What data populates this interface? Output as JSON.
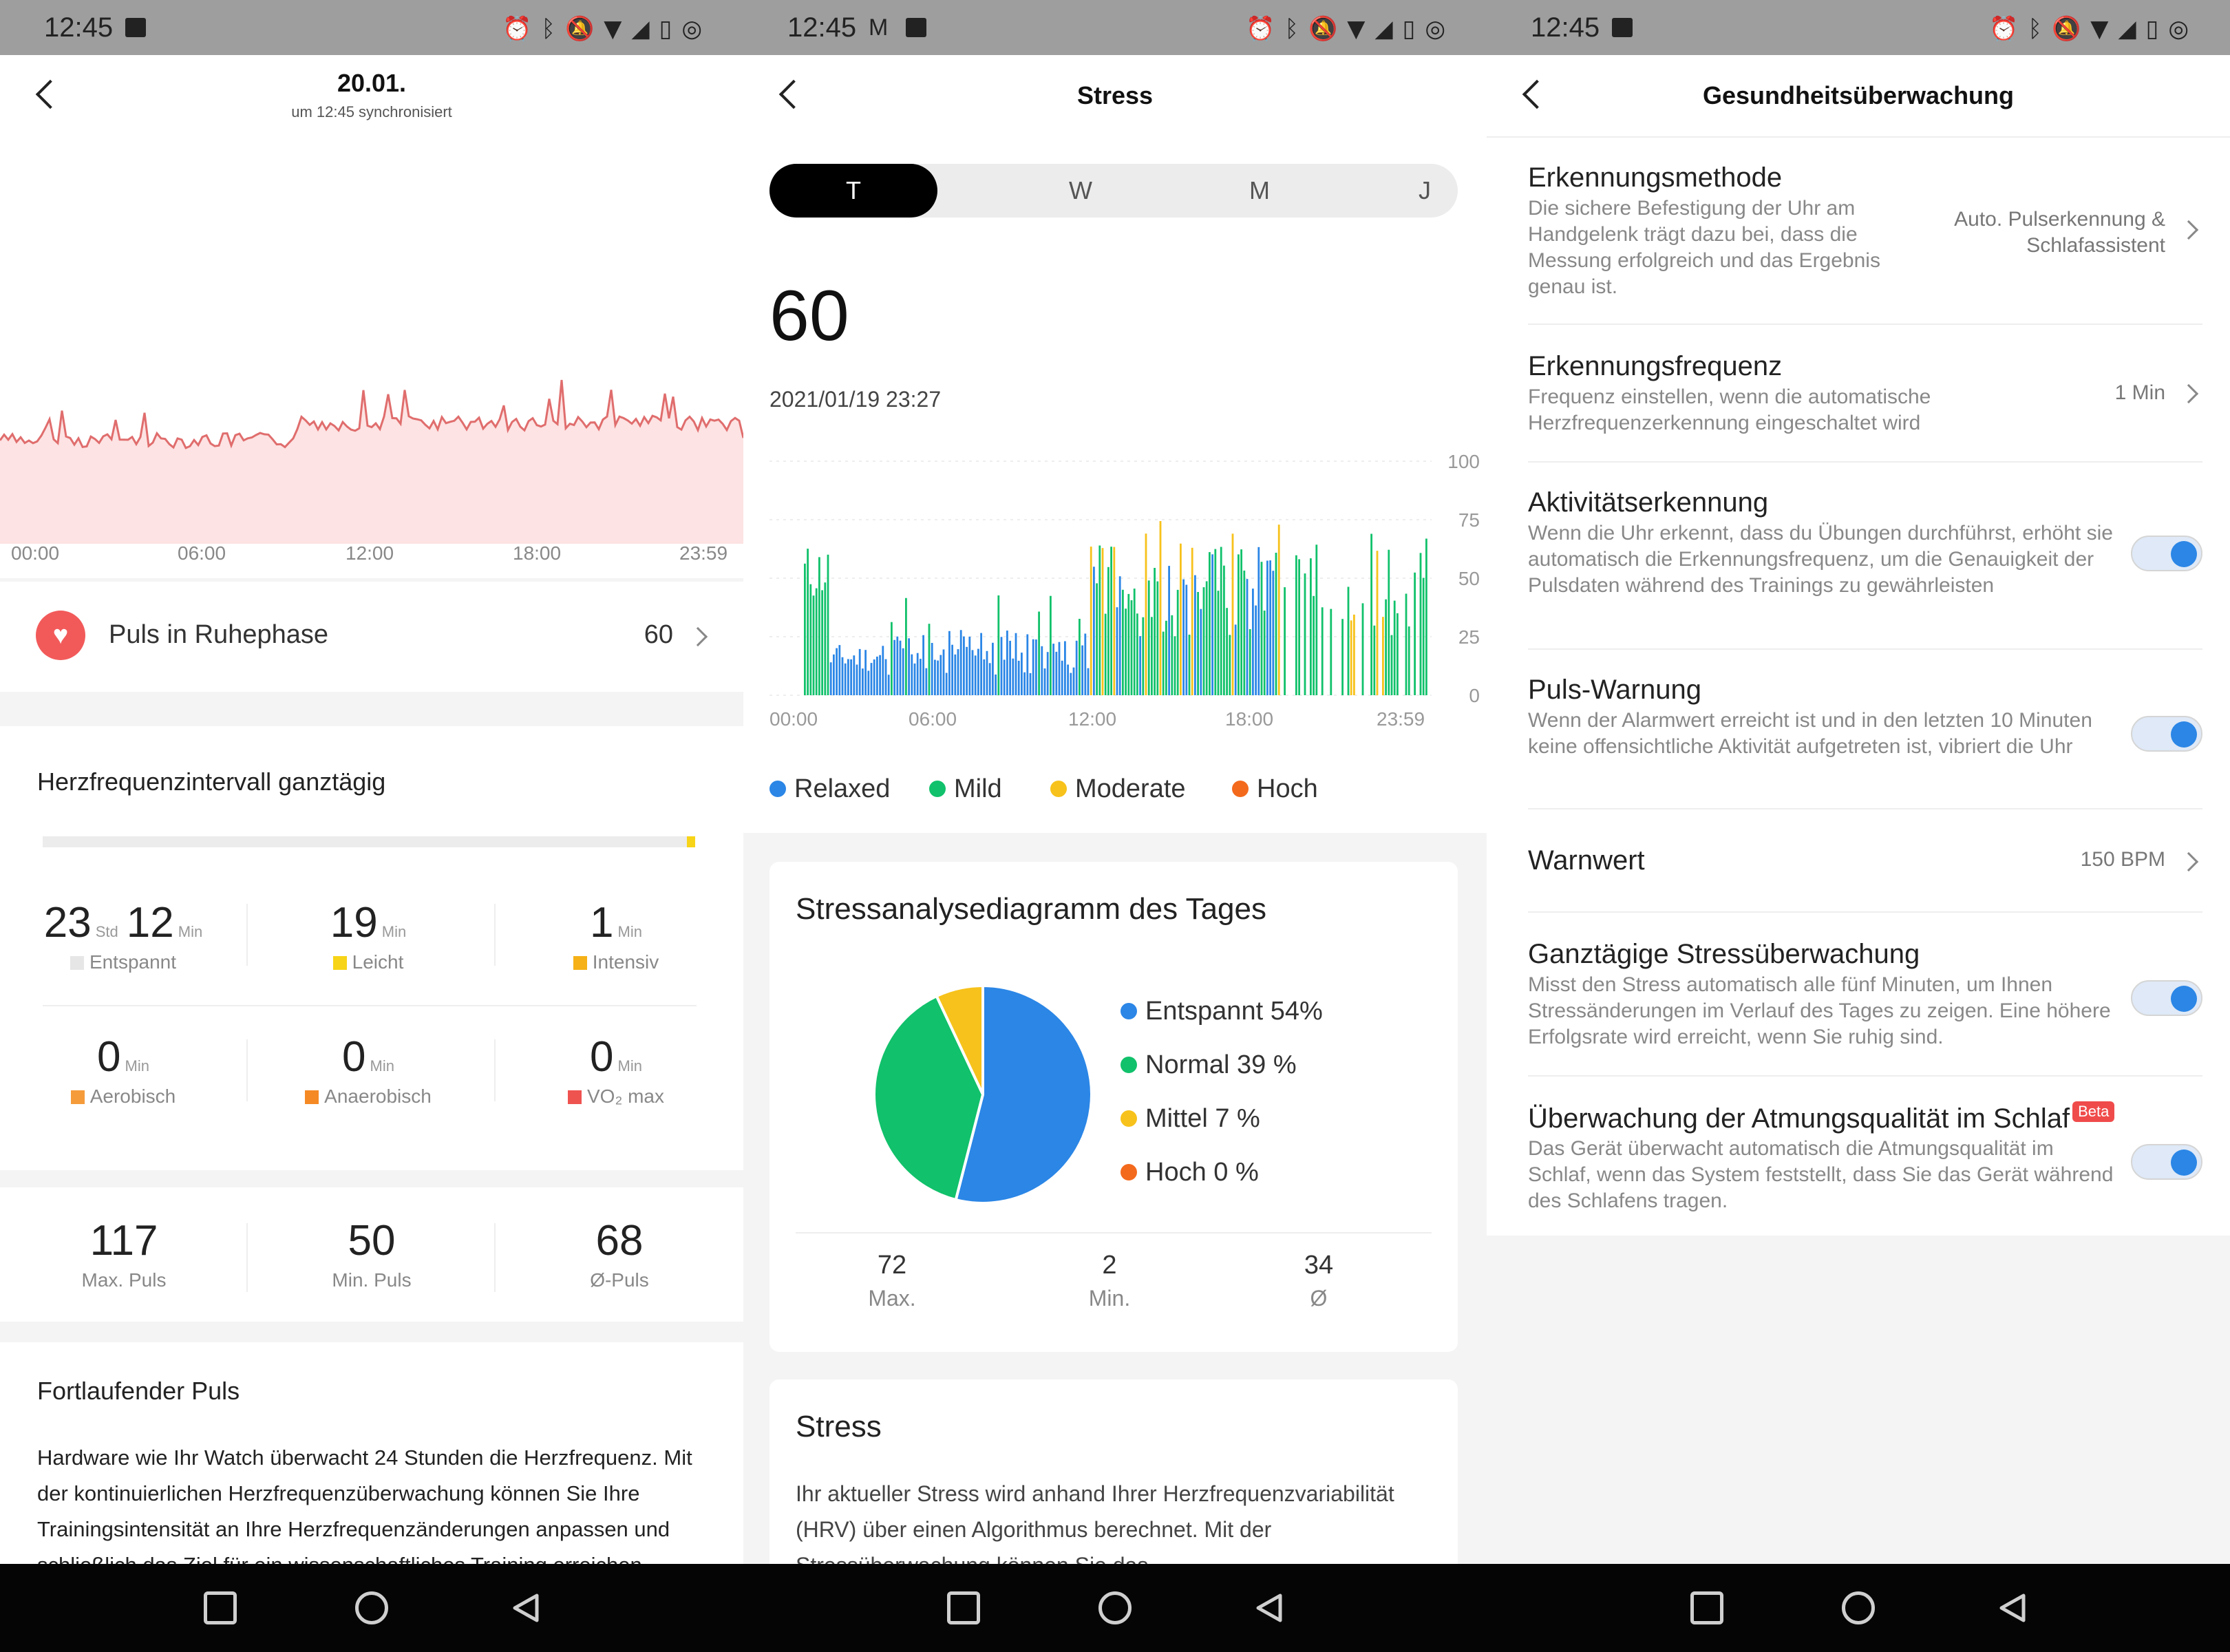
{
  "status_bar": {
    "time": "12:45"
  },
  "panel1": {
    "date": "20.01.",
    "sync": "um 12:45 synchronisiert",
    "hr_axis": [
      "00:00",
      "06:00",
      "12:00",
      "18:00",
      "23:59"
    ],
    "resting": {
      "label": "Puls in Ruhephase",
      "value": "60"
    },
    "zones_title": "Herzfrequenzintervall ganztägig",
    "zones": [
      {
        "value1": "23",
        "unit1": "Std",
        "value2": "12",
        "unit2": "Min",
        "label": "Entspannt",
        "color": "#e6e6e6"
      },
      {
        "value": "19",
        "unit": "Min",
        "label": "Leicht",
        "color": "#f7d417"
      },
      {
        "value": "1",
        "unit": "Min",
        "label": "Intensiv",
        "color": "#f5b117"
      },
      {
        "value": "0",
        "unit": "Min",
        "label": "Aerobisch",
        "color": "#f59b3a"
      },
      {
        "value": "0",
        "unit": "Min",
        "label": "Anaerobisch",
        "color": "#f58a24"
      },
      {
        "value": "0",
        "unit": "Min",
        "label": "VO₂ max",
        "color": "#ef5350"
      }
    ],
    "summary": [
      {
        "value": "117",
        "label": "Max. Puls"
      },
      {
        "value": "50",
        "label": "Min. Puls"
      },
      {
        "value": "68",
        "label": "Ø-Puls"
      }
    ],
    "continuous_title": "Fortlaufender Puls",
    "continuous_text": "Hardware wie Ihr Watch überwacht 24 Stunden die Herzfrequenz. Mit der kontinuierlichen Herzfrequenzüberwachung können Sie Ihre Trainingsintensität an Ihre Herzfrequenzänderungen anpassen und schließlich das Ziel für ein wissenschaftliches Training erreichen."
  },
  "panel2": {
    "title": "Stress",
    "tabs": [
      "T",
      "W",
      "M",
      "J"
    ],
    "selected_tab": "T",
    "value": "60",
    "datetime": "2021/01/19 23:27",
    "y_ticks": [
      "100",
      "75",
      "50",
      "25",
      "0"
    ],
    "x_ticks": [
      "00:00",
      "06:00",
      "12:00",
      "18:00",
      "23:59"
    ],
    "legend": [
      {
        "label": "Relaxed",
        "color": "#2b86e6"
      },
      {
        "label": "Mild",
        "color": "#11c16b"
      },
      {
        "label": "Moderate",
        "color": "#f7c21b"
      },
      {
        "label": "Hoch",
        "color": "#f36a1d"
      }
    ],
    "analysis_title": "Stressanalysediagramm des Tages",
    "pie_legend": [
      {
        "label": "Entspannt 54%",
        "color": "#2b86e6"
      },
      {
        "label": "Normal 39 %",
        "color": "#11c16b"
      },
      {
        "label": "Mittel 7 %",
        "color": "#f7c21b"
      },
      {
        "label": "Hoch 0 %",
        "color": "#f36a1d"
      }
    ],
    "kpis": [
      {
        "value": "72",
        "label": "Max."
      },
      {
        "value": "2",
        "label": "Min."
      },
      {
        "value": "34",
        "label": "Ø"
      }
    ],
    "info_title": "Stress",
    "info_text": "Ihr aktueller Stress wird anhand Ihrer Herzfrequenzvariabilität (HRV) über einen Algorithmus berechnet. Mit der Stressüberwachung können Sie das"
  },
  "panel3": {
    "title": "Gesundheitsüberwachung",
    "settings": [
      {
        "title": "Erkennungsmethode",
        "desc": "Die sichere Befestigung der Uhr am Handgelenk trägt dazu bei, dass die Messung erfolgreich und das Ergebnis genau ist.",
        "value": "Auto. Pulserkennung & Schlafassistent"
      },
      {
        "title": "Erkennungsfrequenz",
        "desc": "Frequenz einstellen, wenn die automatische Herzfrequenzerkennung eingeschaltet wird",
        "value": "1 Min"
      },
      {
        "title": "Aktivitätserkennung",
        "desc": "Wenn die Uhr erkennt, dass du Übungen durchführst, erhöht sie automatisch die Erkennungsfrequenz, um die Genauigkeit der Pulsdaten während des Trainings zu gewährleisten"
      },
      {
        "title": "Puls-Warnung",
        "desc": "Wenn der Alarmwert erreicht ist und in den letzten 10 Minuten keine offensichtliche Aktivität aufgetreten ist, vibriert die Uhr"
      },
      {
        "title": "Warnwert",
        "value": "150 BPM"
      },
      {
        "title": "Ganztägige Stressüberwachung",
        "desc": "Misst den Stress automatisch alle fünf Minuten, um Ihnen Stressänderungen im Verlauf des Tages zu zeigen. Eine höhere Erfolgsrate wird erreicht, wenn Sie ruhig sind."
      },
      {
        "title": "Überwachung der Atmungsqualität im Schlaf",
        "badge": "Beta",
        "desc": "Das Gerät überwacht automatisch die Atmungsqualität im Schlaf, wenn das System feststellt, dass Sie das Gerät während des Schlafens tragen."
      }
    ]
  },
  "chart_data": [
    {
      "type": "pie",
      "categories": [
        "Entspannt",
        "Normal",
        "Mittel",
        "Hoch"
      ],
      "values": [
        54,
        39,
        7,
        0
      ],
      "colors": [
        "#2b86e6",
        "#11c16b",
        "#f7c21b",
        "#f36a1d"
      ]
    },
    {
      "type": "bar",
      "title": "",
      "x_ticks": [
        "00:00",
        "06:00",
        "12:00",
        "18:00",
        "23:59"
      ],
      "ylim": [
        0,
        100
      ],
      "y_ticks": [
        0,
        25,
        50,
        75,
        100
      ]
    }
  ]
}
